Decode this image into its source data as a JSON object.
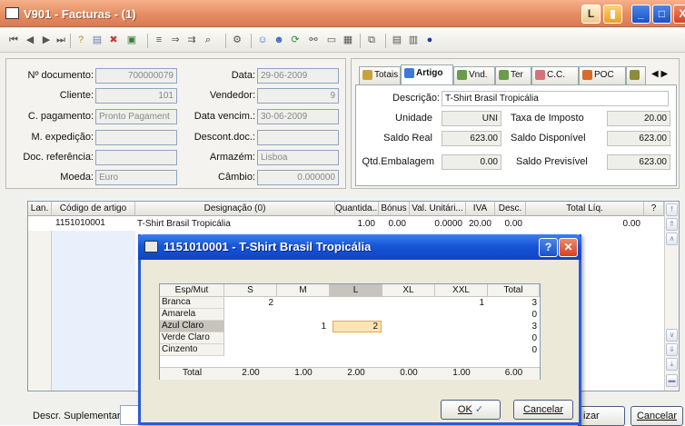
{
  "window": {
    "title": "V901 - Facturas - (1)",
    "buttons": [
      "L",
      "▮",
      "_",
      "□",
      "X"
    ]
  },
  "header": {
    "doc_no_label": "Nº documento:",
    "doc_no": "700000079",
    "cliente_label": "Cliente:",
    "cliente": "101",
    "cpag_label": "C. pagamento:",
    "cpag": "Pronto Pagament",
    "mexp_label": "M. expedição:",
    "mexp": "",
    "docref_label": "Doc. referência:",
    "docref": "",
    "moeda_label": "Moeda:",
    "moeda": "Euro",
    "data_label": "Data:",
    "data": "29-06-2009",
    "vendedor_label": "Vendedor:",
    "vendedor": "9",
    "venc_label": "Data vencim.:",
    "venc": "30-06-2009",
    "desc_label": "Descont.doc.:",
    "desc": "",
    "armazem_label": "Armazém:",
    "armazem": "Lisboa",
    "cambio_label": "Câmbio:",
    "cambio": "0.000000"
  },
  "tabs": [
    "Totais",
    "Artigo",
    "Vnd.",
    "Ter",
    "C.C.",
    "POC"
  ],
  "artigo": {
    "descricao_label": "Descrição:",
    "descricao": "T-Shirt Brasil Tropicália",
    "unidade_label": "Unidade",
    "unidade": "UNI",
    "taxa_label": "Taxa de Imposto",
    "taxa": "20.00",
    "saldo_real_label": "Saldo Real",
    "saldo_real": "623.00",
    "saldo_disp_label": "Saldo Disponível",
    "saldo_disp": "623.00",
    "qtd_emb_label": "Qtd.Embalagem",
    "qtd_emb": "0.00",
    "saldo_prev_label": "Saldo Previsível",
    "saldo_prev": "623.00"
  },
  "grid": {
    "columns": [
      "Lan.",
      "Código de artigo",
      "Designação (0)",
      "Quantida...",
      "Bónus",
      "Val. Unitári...",
      "IVA",
      "Desc.",
      "Total Líq.",
      "?"
    ],
    "row": {
      "codigo": "1151010001",
      "designacao": "T-Shirt Brasil Tropicália",
      "quantidade": "1.00",
      "bonus": "0.00",
      "valor": "0.0000",
      "iva": "20.00",
      "desc": "0.00",
      "total": "0.00"
    }
  },
  "bottom": {
    "descr_label": "Descr. Suplementar:",
    "izar": "izar",
    "cancelar": "Cancelar"
  },
  "dialog": {
    "title": "1151010001 - T-Shirt Brasil Tropicália",
    "columns": [
      "Esp/Mut",
      "S",
      "M",
      "L",
      "XL",
      "XXL",
      "Total"
    ],
    "rows": [
      {
        "name": "Branca",
        "S": "2",
        "M": "",
        "L": "",
        "XL": "",
        "XXL": "1",
        "total": "3"
      },
      {
        "name": "Amarela",
        "S": "",
        "M": "",
        "L": "",
        "XL": "",
        "XXL": "",
        "total": "0"
      },
      {
        "name": "Azul Claro",
        "S": "",
        "M": "1",
        "L": "2",
        "XL": "",
        "XXL": "",
        "total": "3"
      },
      {
        "name": "Verde Claro",
        "S": "",
        "M": "",
        "L": "",
        "XL": "",
        "XXL": "",
        "total": "0"
      },
      {
        "name": "Cinzento",
        "S": "",
        "M": "",
        "L": "",
        "XL": "",
        "XXL": "",
        "total": "0"
      }
    ],
    "totals": {
      "label": "Total",
      "S": "2.00",
      "M": "1.00",
      "L": "2.00",
      "XL": "0.00",
      "XXL": "1.00",
      "total": "6.00"
    },
    "ok": "OK",
    "cancelar": "Cancelar"
  }
}
